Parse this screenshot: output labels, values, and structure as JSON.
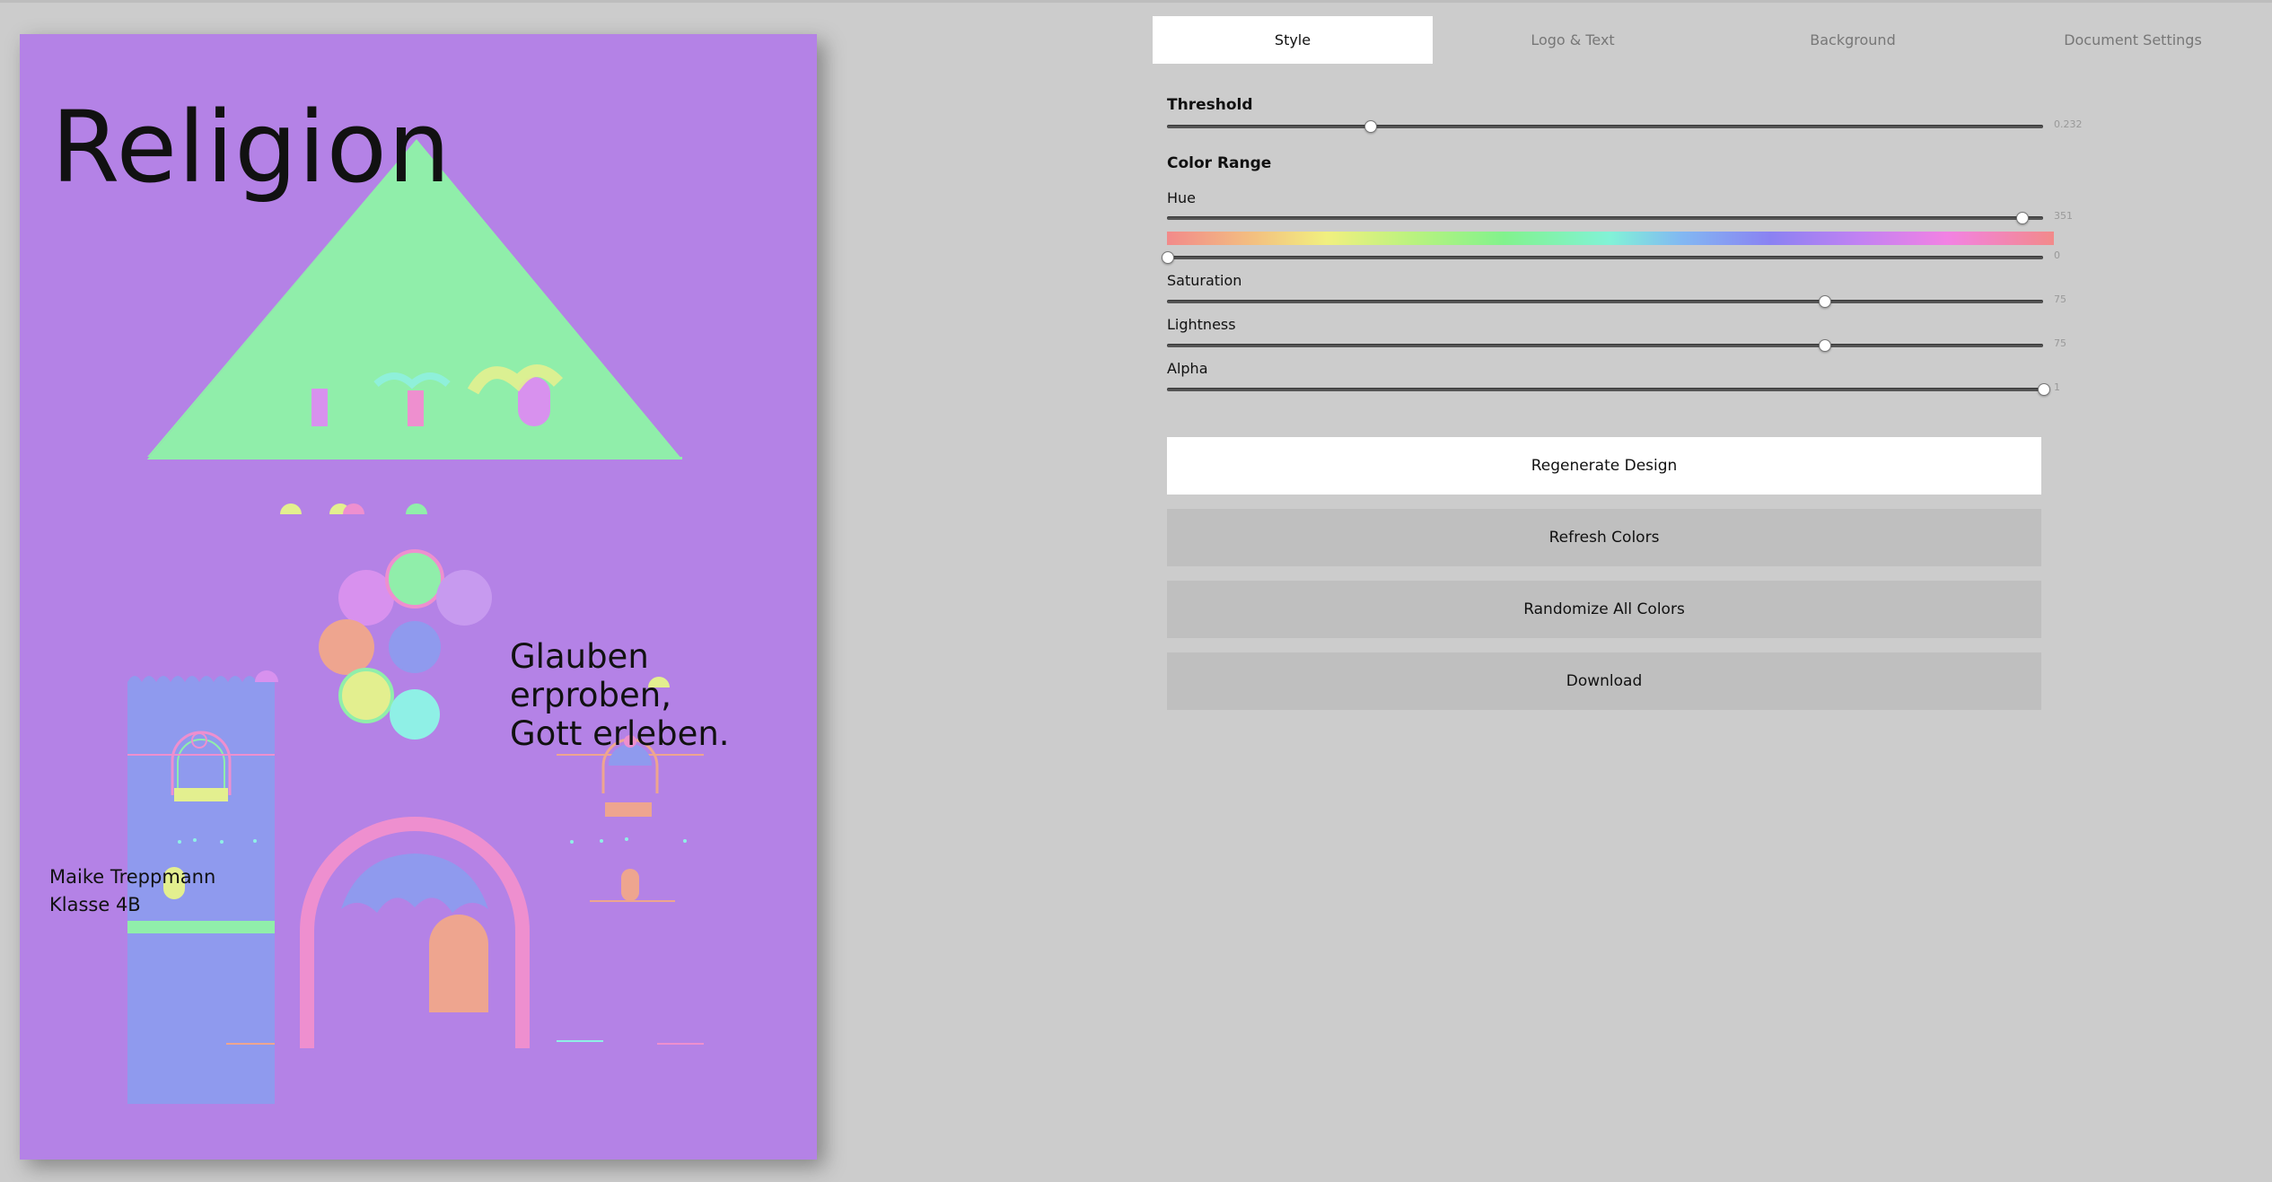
{
  "poster": {
    "title": "Religion",
    "tagline_line1": "Glauben erproben,",
    "tagline_line2": "Gott erleben.",
    "author_name": "Maike Treppmann",
    "author_class": "Klasse 4B"
  },
  "tabs": [
    {
      "label": "Style",
      "active": true
    },
    {
      "label": "Logo & Text",
      "active": false
    },
    {
      "label": "Background",
      "active": false
    },
    {
      "label": "Document Settings",
      "active": false
    }
  ],
  "style": {
    "threshold": {
      "label": "Threshold",
      "value": "0.232",
      "fraction": 0.232
    },
    "color_range_label": "Color Range",
    "hue": {
      "label": "Hue",
      "max_value": "351",
      "max_fraction": 0.975,
      "min_value": "0",
      "min_fraction": 0.0
    },
    "saturation": {
      "label": "Saturation",
      "value": "75",
      "fraction": 0.75
    },
    "lightness": {
      "label": "Lightness",
      "value": "75",
      "fraction": 0.75
    },
    "alpha": {
      "label": "Alpha",
      "value": "1",
      "fraction": 1.0
    }
  },
  "buttons": {
    "regenerate": "Regenerate Design",
    "refresh": "Refresh Colors",
    "randomize": "Randomize All Colors",
    "download": "Download"
  },
  "colors": {
    "poster_bg": "#b482e6",
    "mint": "#90eeaa",
    "periwinkle": "#8f9aee",
    "pink": "#ee8fcf",
    "salmon": "#eea58f",
    "yellow": "#e3ef8f",
    "aqua": "#8ff0e6",
    "orchid": "#d891ee"
  }
}
